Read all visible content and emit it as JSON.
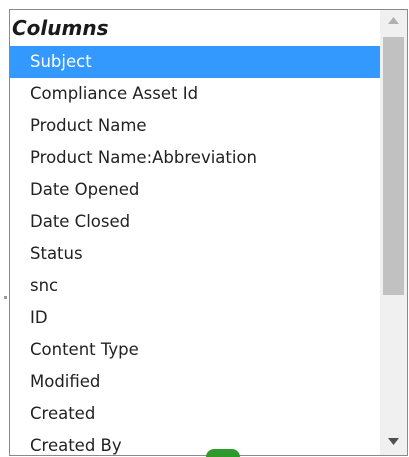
{
  "listbox": {
    "group_label": "Columns",
    "options": [
      "Subject",
      "Compliance Asset Id",
      "Product Name",
      "Product Name:Abbreviation",
      "Date Opened",
      "Date Closed",
      "Status",
      "snc",
      "ID",
      "Content Type",
      "Modified",
      "Created",
      "Created By"
    ],
    "selected_index": 0
  },
  "scrollbar": {
    "up_icon": "triangle-up-icon",
    "down_icon": "triangle-down-icon"
  },
  "colors": {
    "selection": "#3399ff",
    "selection_text": "#ffffff",
    "text": "#222222",
    "border": "#8a8a8a",
    "scroll_track": "#f0f0f0",
    "scroll_thumb": "#c1c1c1"
  }
}
